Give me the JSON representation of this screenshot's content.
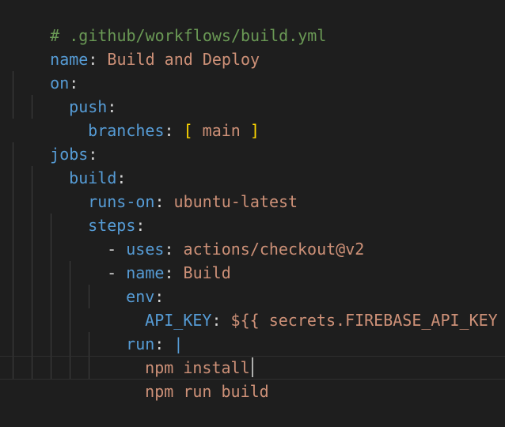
{
  "editor": {
    "theme_colors": {
      "background": "#1e1e1e",
      "comment": "#6a9955",
      "key": "#569cd6",
      "string": "#ce9178",
      "bracket": "#ffd700",
      "punctuation": "#d4d4d4"
    },
    "lines": [
      {
        "comment": "# .github/workflows/build.yml"
      },
      {
        "key": "name",
        "colon": ":",
        "value": " Build and Deploy"
      },
      {
        "key": "on",
        "colon": ":"
      },
      {
        "key": "push",
        "colon": ":"
      },
      {
        "key": "branches",
        "colon": ":",
        "open": " [",
        "value": " main ",
        "close": "]"
      },
      {
        "key": "jobs",
        "colon": ":"
      },
      {
        "key": "build",
        "colon": ":"
      },
      {
        "key": "runs-on",
        "colon": ":",
        "value": " ubuntu-latest"
      },
      {
        "key": "steps",
        "colon": ":"
      },
      {
        "dash": "- ",
        "key": "uses",
        "colon": ":",
        "value": " actions/checkout@v2"
      },
      {
        "dash": "- ",
        "key": "name",
        "colon": ":",
        "value": " Build"
      },
      {
        "key": "env",
        "colon": ":"
      },
      {
        "key": "API_KEY",
        "colon": ":",
        "value": " ${{ secrets.FIREBASE_API_KEY }}"
      },
      {
        "key": "run",
        "colon": ":",
        "pipe": " |"
      },
      {
        "value": "npm install"
      },
      {
        "value": "npm run build"
      }
    ]
  }
}
